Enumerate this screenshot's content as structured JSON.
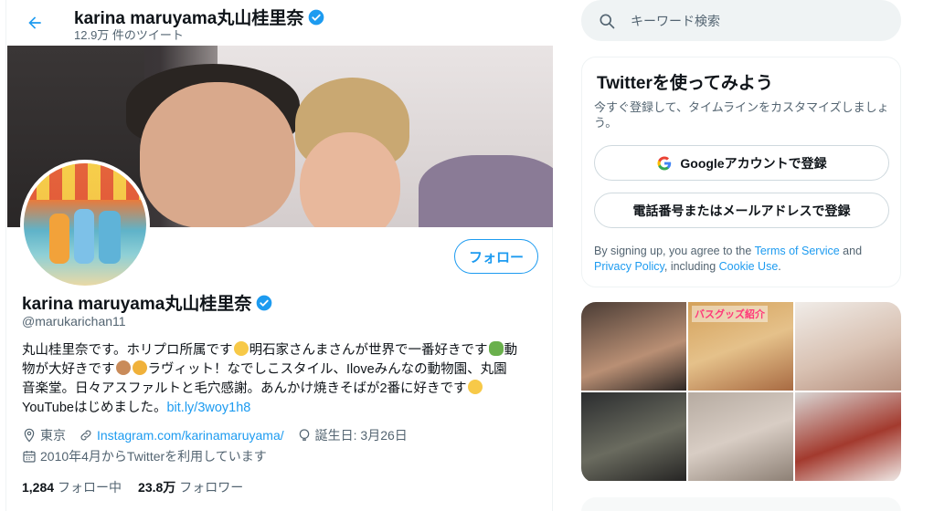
{
  "header": {
    "name": "karina maruyama丸山桂里奈",
    "tweet_count": "12.9万 件のツイート"
  },
  "profile": {
    "display_name": "karina maruyama丸山桂里奈",
    "handle": "@marukarichan11",
    "follow_label": "フォロー",
    "bio": {
      "line1a": "丸山桂里奈です。ホリプロ所属です",
      "line1b": "明石家さんまさんが世界で一番好きです",
      "line1c": "動",
      "line2a": "物が大好きです",
      "line2b": "ラヴィット！なでしこスタイル、Iloveみんなの動物園、丸園",
      "line3": "音楽堂。日々アスファルトと毛穴感謝。あんかけ焼きそばが2番に好きです",
      "line4_text": "YouTubeはじめました。",
      "line4_link": "bit.ly/3woy1h8"
    },
    "location": "東京",
    "website": "Instagram.com/karinamaruyama/",
    "birthday": "誕生日: 3月26日",
    "joined": "2010年4月からTwitterを利用しています",
    "following_count": "1,284",
    "following_label": "フォロー中",
    "followers_count": "23.8万",
    "followers_label": "フォロワー"
  },
  "sidebar": {
    "search_placeholder": "キーワード検索",
    "signup": {
      "title": "Twitterを使ってみよう",
      "subtitle": "今すぐ登録して、タイムラインをカスタマイズしましょう。",
      "google_button": "Googleアカウントで登録",
      "phone_button": "電話番号またはメールアドレスで登録",
      "legal_prefix": "By signing up, you agree to the",
      "terms": "Terms of Service",
      "and": "and",
      "privacy": "Privacy Policy",
      "including": ", including",
      "cookie": "Cookie Use",
      "period": "."
    },
    "media_caption": "バスグッズ紹介"
  },
  "colors": {
    "accent": "#1d9bf0",
    "secondary_text": "#536471",
    "verified": "#1d9bf0"
  }
}
